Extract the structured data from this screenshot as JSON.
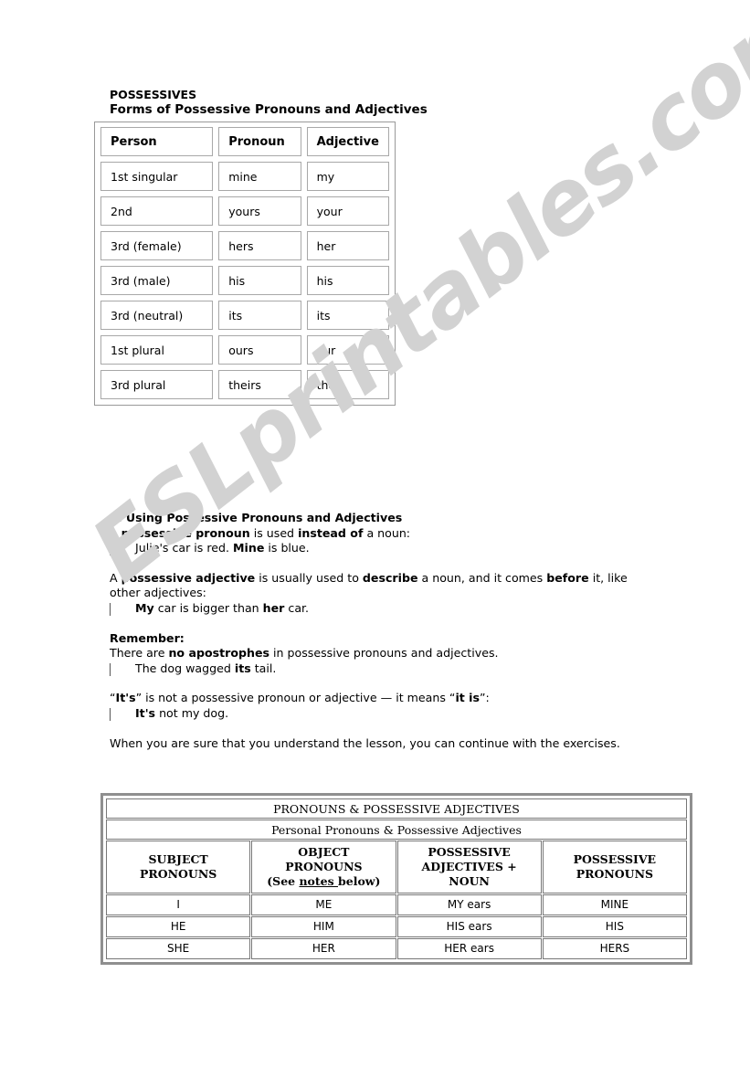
{
  "watermark": {
    "text": "ESLprintables.com",
    "color": "#d2d2d2"
  },
  "heading": {
    "line1": "POSSESSIVES",
    "line2": "Forms of Possessive Pronouns and Adjectives"
  },
  "forms_table": {
    "headers": [
      "Person",
      "Pronoun",
      "Adjective"
    ],
    "rows": [
      [
        "1st singular",
        "mine",
        "my"
      ],
      [
        "2nd",
        "yours",
        "your"
      ],
      [
        "3rd (female)",
        "hers",
        "her"
      ],
      [
        "3rd (male)",
        "his",
        "his"
      ],
      [
        "3rd (neutral)",
        "its",
        "its"
      ],
      [
        "1st plural",
        "ours",
        "our"
      ],
      [
        "3rd plural",
        "theirs",
        "their"
      ]
    ]
  },
  "prose": {
    "section_title": "2. Using Possessive Pronouns and Adjectives",
    "p1_a": "A ",
    "p1_b": "possessive pronoun",
    "p1_c": " is used ",
    "p1_d": "instead of",
    "p1_e": " a noun:",
    "ex1_a": "Julie's car is red. ",
    "ex1_b": "Mine",
    "ex1_c": " is blue.",
    "p2_a": "A ",
    "p2_b": "possessive adjective",
    "p2_c": " is usually used to ",
    "p2_d": "describe",
    "p2_e": " a noun, and it comes ",
    "p2_f": "before",
    "p2_g": " it, like other adjectives:",
    "ex2_a": "My",
    "ex2_b": " car is bigger than ",
    "ex2_c": "her",
    "ex2_d": " car.",
    "remember_label": "Remember:",
    "p3_a": "There are ",
    "p3_b": "no apostrophes",
    "p3_c": " in possessive pronouns and adjectives.",
    "ex3_a": "The dog wagged ",
    "ex3_b": "its",
    "ex3_c": " tail.",
    "p4_a": "“",
    "p4_b": "It's",
    "p4_c": "” is not a possessive pronoun or adjective — it means “",
    "p4_d": "it is",
    "p4_e": "”:",
    "ex4_a": "It's",
    "ex4_b": " not my dog.",
    "p5": "When you are sure that you understand the lesson, you can continue with the exercises."
  },
  "pron_table": {
    "title": "PRONOUNS & POSSESSIVE ADJECTIVES",
    "subtitle": "Personal Pronouns & Possessive Adjectives",
    "headers": {
      "col0_l1": "SUBJECT",
      "col0_l2": "PRONOUNS",
      "col1_l1": "OBJECT",
      "col1_l2": "PRONOUNS",
      "col1_l3_a": "(See ",
      "col1_l3_b": "notes ",
      "col1_l3_c": "below)",
      "col2_l1": "POSSESSIVE",
      "col2_l2": "ADJECTIVES +",
      "col2_l3": "NOUN",
      "col3": "POSSESSIVE PRONOUNS"
    },
    "rows": [
      [
        "I",
        "ME",
        "MY ears",
        "MINE"
      ],
      [
        "HE",
        "HIM",
        "HIS ears",
        "HIS"
      ],
      [
        "SHE",
        "HER",
        "HER ears",
        "HERS"
      ]
    ]
  }
}
